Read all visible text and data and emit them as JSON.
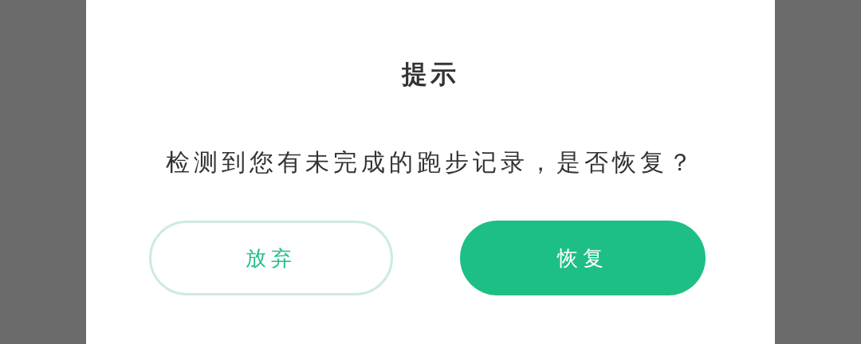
{
  "dialog": {
    "title": "提示",
    "message": "检测到您有未完成的跑步记录，是否恢复？",
    "buttons": [
      {
        "label": "放弃",
        "kind": "secondary"
      },
      {
        "label": "恢复",
        "kind": "primary"
      }
    ]
  }
}
